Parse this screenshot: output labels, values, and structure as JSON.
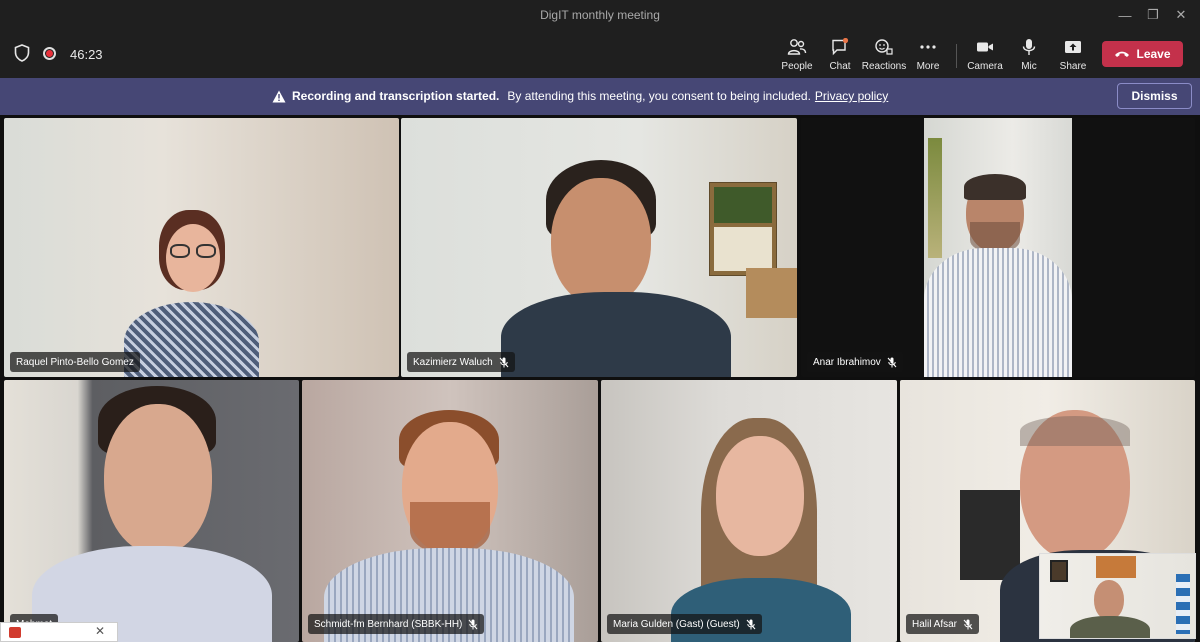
{
  "window": {
    "title": "DigIT monthly meeting",
    "minimize": "—",
    "restore": "❐",
    "close": "✕"
  },
  "toolbar": {
    "timer": "46:23",
    "people": "People",
    "chat": "Chat",
    "reactions": "Reactions",
    "more": "More",
    "camera": "Camera",
    "mic": "Mic",
    "share": "Share",
    "leave": "Leave"
  },
  "banner": {
    "bold": "Recording and transcription started.",
    "text": "By attending this meeting, you consent to being included.",
    "link": "Privacy policy",
    "dismiss": "Dismiss"
  },
  "participants": [
    {
      "name": "Raquel Pinto-Bello Gomez"
    },
    {
      "name": "Kazimierz Waluch"
    },
    {
      "name": "Anar Ibrahimov"
    },
    {
      "name": "Mehmet"
    },
    {
      "name": "Schmidt-fm Bernhard (SBBK-HH)"
    },
    {
      "name": "Maria Gulden (Gast) (Guest)"
    },
    {
      "name": "Halil Afsar"
    }
  ],
  "icons": {
    "shield": "shield-icon",
    "record": "record-icon",
    "people": "people-icon",
    "chat": "chat-icon",
    "reactions": "reactions-icon",
    "more": "more-icon",
    "camera": "camera-icon",
    "mic": "mic-icon",
    "share": "share-icon",
    "leave": "phone-hangup-icon",
    "warning": "warning-icon",
    "mic_off": "mic-off-icon"
  },
  "colors": {
    "leave": "#c4314b",
    "banner": "#464775",
    "chat_badge": "#e97548",
    "record": "#e8313b"
  }
}
